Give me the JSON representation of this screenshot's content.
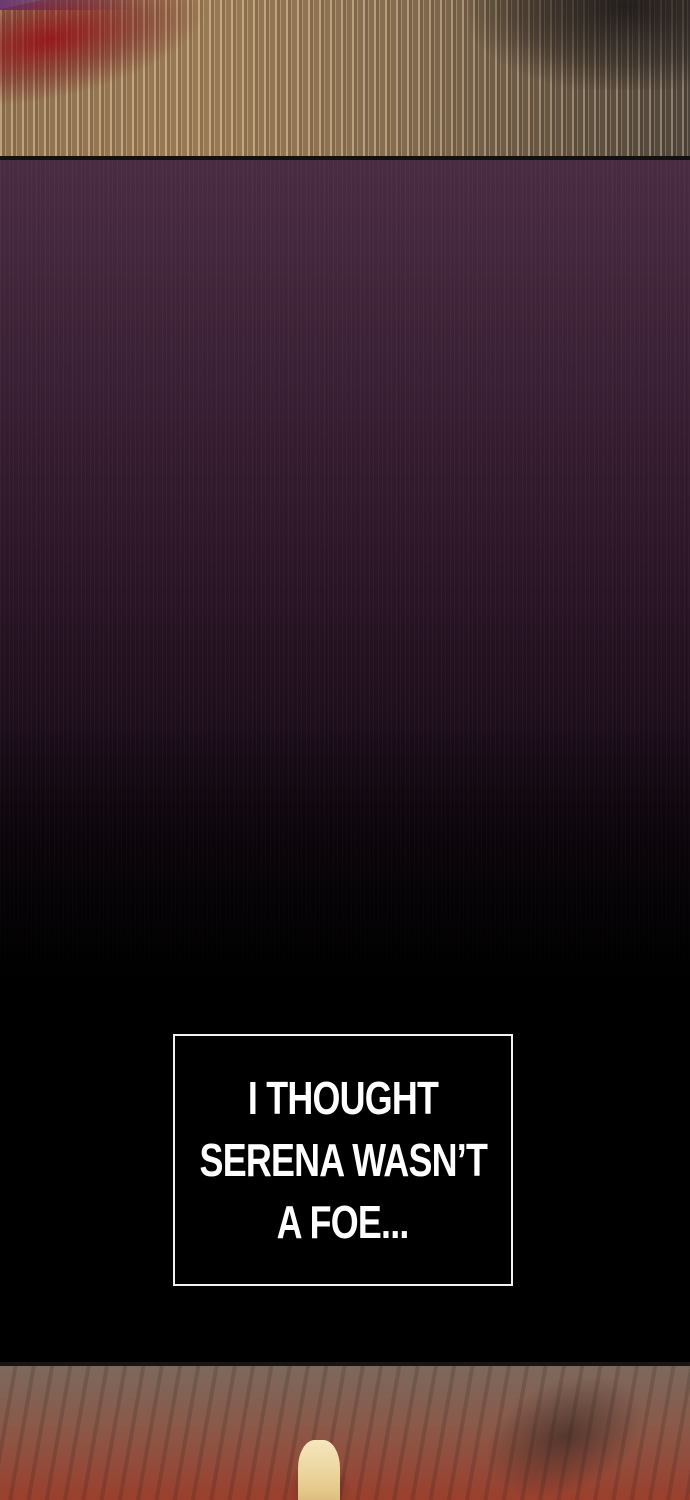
{
  "caption": {
    "lines": [
      "I THOUGHT",
      "SERENA WASN’T",
      "A FOE..."
    ]
  },
  "colors": {
    "background": "#000000",
    "caption_text": "#ffffff",
    "caption_border": "#f2f2f2",
    "dark_panel_top": "#4a2c42",
    "blood_red": "#960a14",
    "figure_gold": "#e9cf95"
  }
}
